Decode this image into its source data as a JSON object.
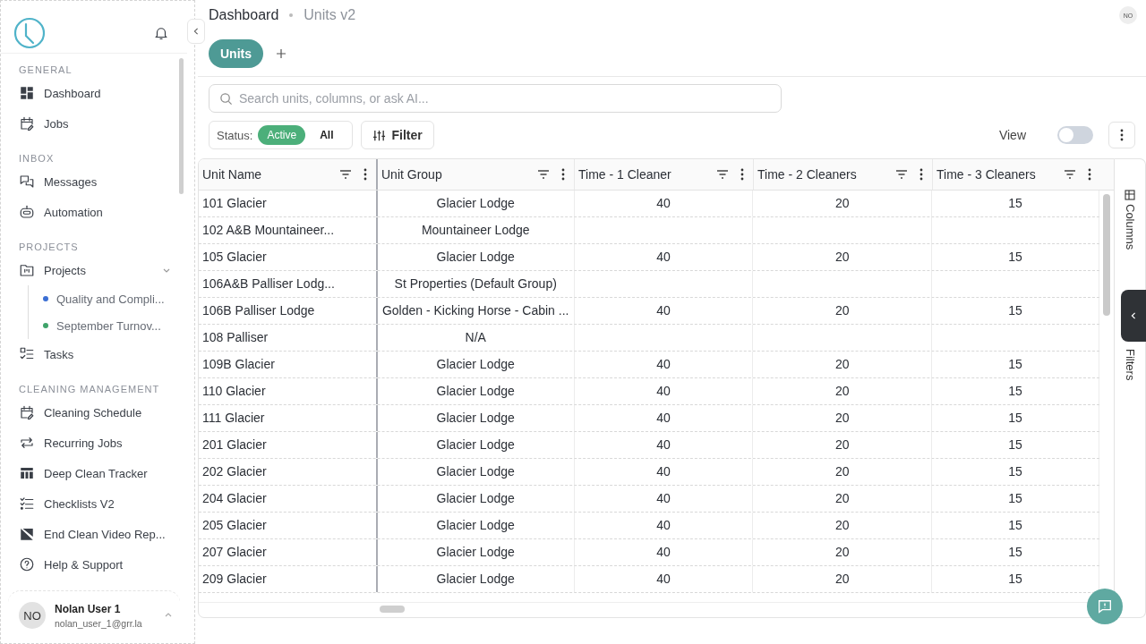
{
  "breadcrumb": [
    {
      "label": "Dashboard",
      "selected": false
    },
    {
      "label": "Units v2",
      "selected": true
    }
  ],
  "user_initials_top": "NO",
  "sidebar": {
    "sections": [
      {
        "title": "GENERAL",
        "items": [
          {
            "label": "Dashboard"
          },
          {
            "label": "Jobs"
          }
        ]
      },
      {
        "title": "INBOX",
        "items": [
          {
            "label": "Messages"
          },
          {
            "label": "Automation"
          }
        ]
      },
      {
        "title": "PROJECTS",
        "items": [
          {
            "label": "Projects",
            "expanded": true,
            "children": [
              {
                "label": "Quality and Compli...",
                "color": "#3b6fd4"
              },
              {
                "label": "September Turnov...",
                "color": "#3fa36a"
              }
            ]
          },
          {
            "label": "Tasks"
          }
        ]
      },
      {
        "title": "CLEANING MANAGEMENT",
        "items": [
          {
            "label": "Cleaning Schedule"
          },
          {
            "label": "Recurring Jobs"
          },
          {
            "label": "Deep Clean Tracker"
          },
          {
            "label": "Checklists V2"
          },
          {
            "label": "End Clean Video Rep..."
          },
          {
            "label": "Help & Support"
          }
        ]
      }
    ],
    "user": {
      "initials": "NO",
      "name": "Nolan User 1",
      "email": "nolan_user_1@grr.la"
    }
  },
  "tabs": [
    {
      "label": "Units",
      "selected": true
    }
  ],
  "search": {
    "placeholder": "Search units, columns, or ask AI..."
  },
  "status": {
    "label": "Status:",
    "options": [
      {
        "label": "Active",
        "selected": true
      },
      {
        "label": "All",
        "selected": false
      }
    ]
  },
  "filter_button": "Filter",
  "view": {
    "label": "View",
    "on": false
  },
  "table": {
    "columns": [
      "Unit Name",
      "Unit Group",
      "Time - 1 Cleaner",
      "Time - 2 Cleaners",
      "Time - 3 Cleaners"
    ],
    "rows": [
      [
        "101 Glacier",
        "Glacier Lodge",
        "40",
        "20",
        "15"
      ],
      [
        "102 A&B Mountaineer...",
        "Mountaineer Lodge",
        null,
        null,
        null
      ],
      [
        "105 Glacier",
        "Glacier Lodge",
        "40",
        "20",
        "15"
      ],
      [
        "106A&B Palliser Lodg...",
        "St Properties (Default Group)",
        null,
        null,
        null
      ],
      [
        "106B Palliser Lodge",
        "Golden - Kicking Horse - Cabin ...",
        "40",
        "20",
        "15"
      ],
      [
        "108 Palliser",
        "N/A",
        null,
        null,
        null
      ],
      [
        "109B Glacier",
        "Glacier Lodge",
        "40",
        "20",
        "15"
      ],
      [
        "110 Glacier",
        "Glacier Lodge",
        "40",
        "20",
        "15"
      ],
      [
        "111 Glacier",
        "Glacier Lodge",
        "40",
        "20",
        "15"
      ],
      [
        "201 Glacier",
        "Glacier Lodge",
        "40",
        "20",
        "15"
      ],
      [
        "202 Glacier",
        "Glacier Lodge",
        "40",
        "20",
        "15"
      ],
      [
        "204 Glacier",
        "Glacier Lodge",
        "40",
        "20",
        "15"
      ],
      [
        "205 Glacier",
        "Glacier Lodge",
        "40",
        "20",
        "15"
      ],
      [
        "207 Glacier",
        "Glacier Lodge",
        "40",
        "20",
        "15"
      ],
      [
        "209 Glacier",
        "Glacier Lodge",
        "40",
        "20",
        "15"
      ]
    ]
  },
  "side_panel": [
    {
      "label": "Columns"
    },
    {
      "label": "Filters"
    }
  ]
}
